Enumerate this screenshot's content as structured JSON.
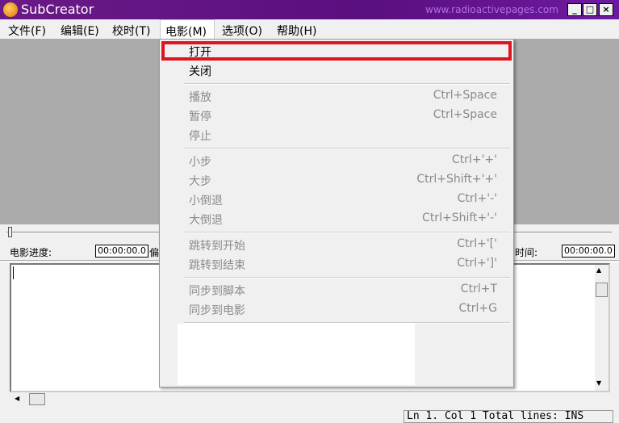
{
  "window": {
    "title": "SubCreator",
    "url": "www.radioactivepages.com",
    "controls": [
      "_",
      "□",
      "×"
    ]
  },
  "menubar": [
    "文件(F)",
    "编辑(E)",
    "校时(T)",
    "电影(M)",
    "选项(O)",
    "帮助(H)"
  ],
  "movie_menu": {
    "groups": [
      [
        {
          "label": "打开",
          "shortcut": "",
          "enabled": true,
          "highlighted": true
        },
        {
          "label": "关闭",
          "shortcut": "",
          "enabled": true
        }
      ],
      [
        {
          "label": "播放",
          "shortcut": "Ctrl+Space",
          "enabled": false
        },
        {
          "label": "暂停",
          "shortcut": "Ctrl+Space",
          "enabled": false
        },
        {
          "label": "停止",
          "shortcut": "",
          "enabled": false
        }
      ],
      [
        {
          "label": "小步",
          "shortcut": "Ctrl+'+'",
          "enabled": false
        },
        {
          "label": "大步",
          "shortcut": "Ctrl+Shift+'+'",
          "enabled": false
        },
        {
          "label": "小倒退",
          "shortcut": "Ctrl+'-'",
          "enabled": false
        },
        {
          "label": "大倒退",
          "shortcut": "Ctrl+Shift+'-'",
          "enabled": false
        }
      ],
      [
        {
          "label": "跳转到开始",
          "shortcut": "Ctrl+'['",
          "enabled": false
        },
        {
          "label": "跳转到结束",
          "shortcut": "Ctrl+']'",
          "enabled": false
        }
      ],
      [
        {
          "label": "同步到脚本",
          "shortcut": "Ctrl+T",
          "enabled": false
        },
        {
          "label": "同步到电影",
          "shortcut": "Ctrl+G",
          "enabled": false
        }
      ]
    ]
  },
  "controls": {
    "progress_label": "电影进度:",
    "progress_value": "00:00:00.0",
    "offset_label_partial": "偏",
    "time_label_partial": "时间:",
    "time_value": "00:00:00.0"
  },
  "status": {
    "text": "Ln 1. Col 1  Total lines: INS"
  }
}
